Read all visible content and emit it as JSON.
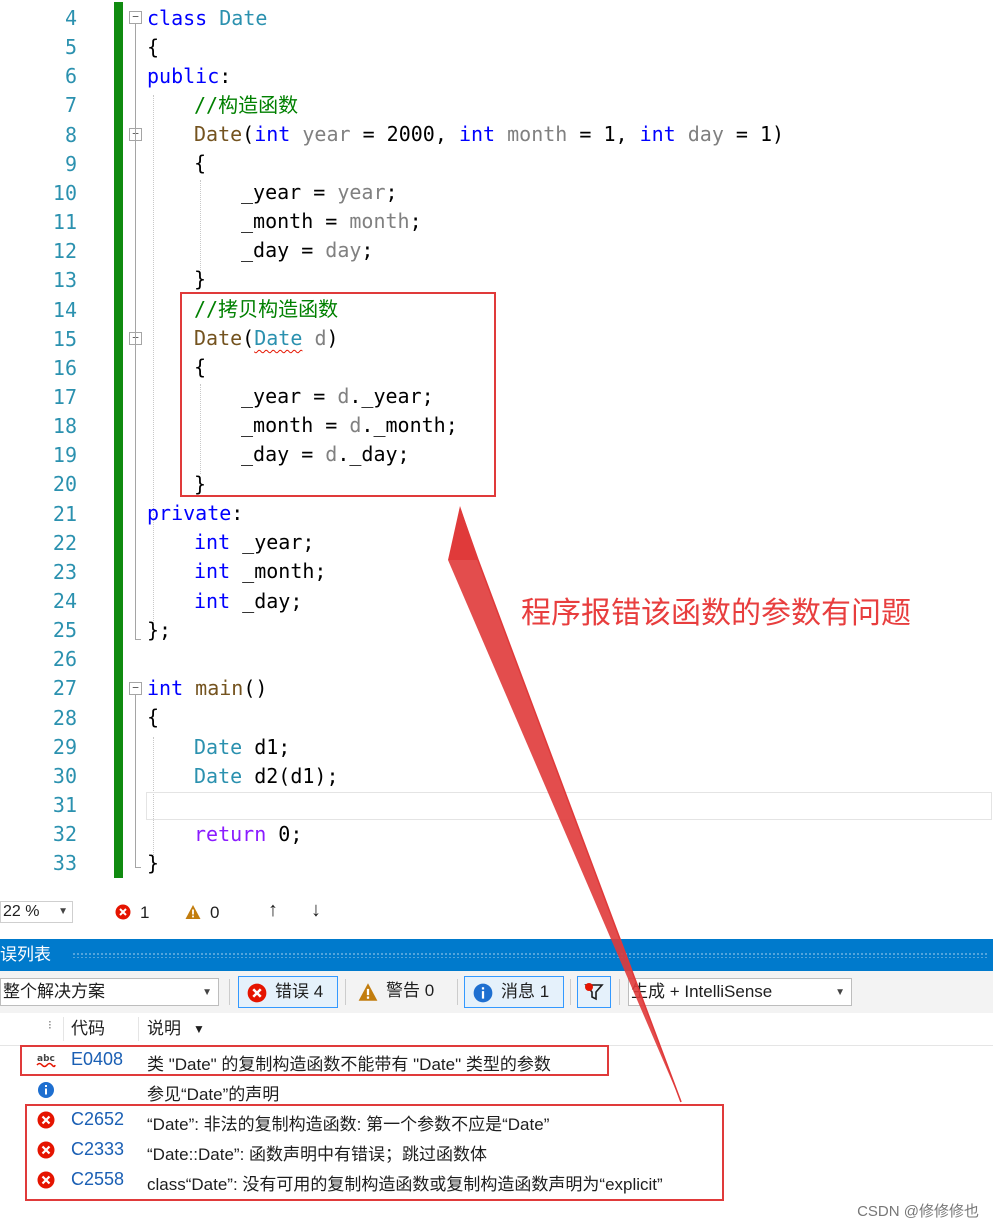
{
  "editor": {
    "line_numbers": [
      "4",
      "5",
      "6",
      "7",
      "8",
      "9",
      "10",
      "11",
      "12",
      "13",
      "14",
      "15",
      "16",
      "17",
      "18",
      "19",
      "20",
      "21",
      "22",
      "23",
      "24",
      "25",
      "26",
      "27",
      "28",
      "29",
      "30",
      "31",
      "32",
      "33"
    ],
    "lines": {
      "l4": {
        "kw": "class",
        "name": "Date"
      },
      "l5": "{",
      "l6": {
        "kw": "public",
        "punct": ":"
      },
      "l7": "//构造函数",
      "l8": {
        "ctor": "Date",
        "open": "(",
        "t1": "int",
        "p1": "year",
        "a1": " = 2000, ",
        "t2": "int",
        "p2": "month",
        "a2": " = 1, ",
        "t3": "int",
        "p3": "day",
        "a3": " = 1)"
      },
      "l9": "{",
      "l10": {
        "m": "_year",
        "eq": " = ",
        "p": "year",
        "end": ";"
      },
      "l11": {
        "m": "_month",
        "eq": " = ",
        "p": "month",
        "end": ";"
      },
      "l12": {
        "m": "_day",
        "eq": " = ",
        "p": "day",
        "end": ";"
      },
      "l13": "}",
      "l14": "//拷贝构造函数",
      "l15": {
        "ctor": "Date",
        "open": "(",
        "t": "Date",
        "p": "d",
        "close": ")"
      },
      "l16": "{",
      "l17": {
        "m": "_year",
        "eq": " = ",
        "p": "d",
        "rest": "._year;"
      },
      "l18": {
        "m": "_month",
        "eq": " = ",
        "p": "d",
        "rest": "._month;"
      },
      "l19": {
        "m": "_day",
        "eq": " = ",
        "p": "d",
        "rest": "._day;"
      },
      "l20": "}",
      "l21": {
        "kw": "private",
        "punct": ":"
      },
      "l22": {
        "t": "int",
        "rest": " _year;"
      },
      "l23": {
        "t": "int",
        "rest": " _month;"
      },
      "l24": {
        "t": "int",
        "rest": " _day;"
      },
      "l25": "};",
      "l27": {
        "t": "int",
        "fn": "main",
        "rest": "()"
      },
      "l28": "{",
      "l29": {
        "t": "Date",
        "rest": " d1;"
      },
      "l30": {
        "t": "Date",
        "rest": " d2(d1);"
      },
      "l32": {
        "kw": "return",
        "rest": " 0;"
      },
      "l33": "}"
    },
    "annotation": "程序报错该函数的参数有问题"
  },
  "status_bar": {
    "zoom": "22 %",
    "error_count": "1",
    "warning_count": "0",
    "up_arrow": "↑",
    "down_arrow": "↓"
  },
  "error_list": {
    "title": "错误列表",
    "scope": "整个解决方案",
    "errors_label": "错误 4",
    "warnings_label": "警告 0",
    "messages_label": "消息 1",
    "build_filter": "生成 + IntelliSense",
    "col_code": "代码",
    "col_desc": "说明",
    "rows": [
      {
        "code": "E0408",
        "desc": "类 \"Date\" 的复制构造函数不能带有 \"Date\" 类型的参数",
        "icon": "squiggle-abc-icon"
      },
      {
        "code": "",
        "desc": "参见“Date”的声明",
        "icon": "info-icon"
      },
      {
        "code": "C2652",
        "desc": "“Date”: 非法的复制构造函数: 第一个参数不应是“Date”",
        "icon": "error-icon"
      },
      {
        "code": "C2333",
        "desc": "“Date::Date”: 函数声明中有错误；跳过函数体",
        "icon": "error-icon"
      },
      {
        "code": "C2558",
        "desc": "class“Date”: 没有可用的复制构造函数或复制构造函数声明为“explicit”",
        "icon": "error-icon"
      }
    ]
  },
  "watermark": "CSDN @修修修也",
  "colors": {
    "accent": "#007acc",
    "highlight_red": "#e03a3a",
    "change_bar": "#108b10",
    "keyword": "#0000ff",
    "type": "#2b91af",
    "comment": "#008000"
  }
}
